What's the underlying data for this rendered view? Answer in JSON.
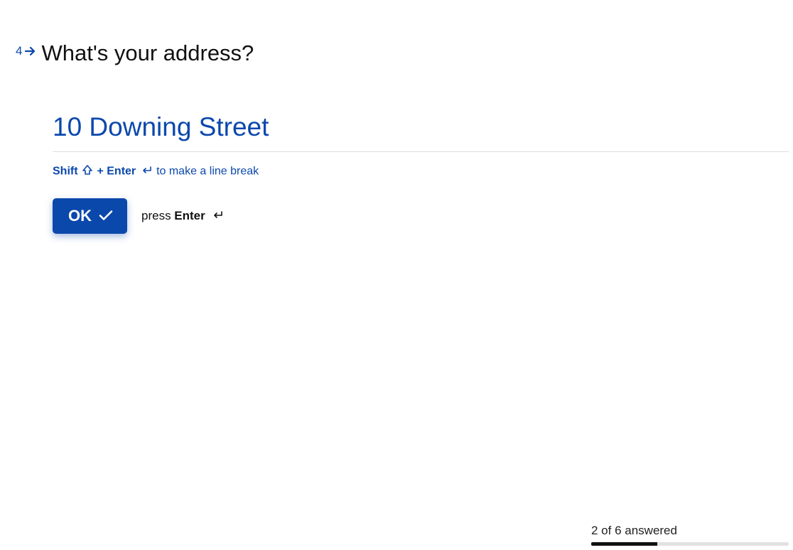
{
  "question": {
    "number": "4",
    "title": "What's your address?",
    "answer": "10 Downing Street",
    "hint": {
      "shift_label": "Shift",
      "plus": " + ",
      "enter_label": "Enter",
      "tail": " to make a line break"
    },
    "ok_label": "OK",
    "press_prefix": "press ",
    "press_key": "Enter"
  },
  "progress": {
    "answered": 2,
    "total": 6,
    "label": "2 of 6 answered",
    "percent": 33.3333
  },
  "colors": {
    "accent": "#0b48ac"
  }
}
